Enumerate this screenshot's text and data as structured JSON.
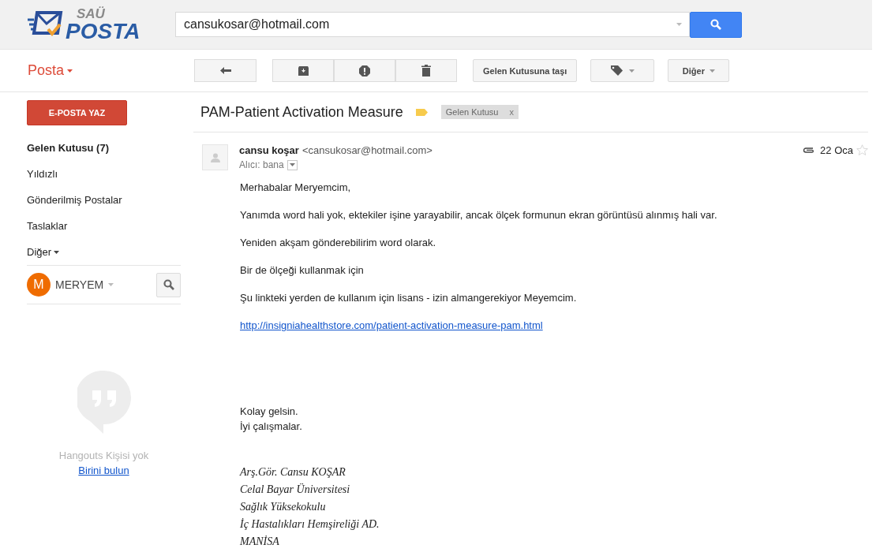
{
  "header": {
    "logo_top": "SAÜ",
    "logo_bottom": "POSTA",
    "search": {
      "value": "cansukosar@hotmail.com"
    }
  },
  "app_menu": "Posta",
  "toolbar": {
    "groups": [
      [
        {
          "kind": "reply"
        }
      ],
      [
        {
          "kind": "archive"
        },
        {
          "kind": "spam"
        },
        {
          "kind": "delete"
        }
      ]
    ],
    "move_button": "Gelen Kutusuna taşı",
    "more_button": "Diğer"
  },
  "sidebar": {
    "compose": "E-POSTA YAZ",
    "items": [
      {
        "label": "Gelen Kutusu (7)",
        "selected": true,
        "kind": "link"
      },
      {
        "label": "Yıldızlı",
        "selected": false,
        "kind": "link"
      },
      {
        "label": "Gönderilmiş Postalar",
        "selected": false,
        "kind": "link"
      },
      {
        "label": "Taslaklar",
        "selected": false,
        "kind": "link"
      },
      {
        "label": "Diğer",
        "selected": false,
        "kind": "menu"
      }
    ],
    "user": {
      "initial": "M",
      "name": "MERYEM"
    },
    "hangouts": {
      "empty_text": "Hangouts Kişisi yok",
      "link": "Birini bulun"
    }
  },
  "message": {
    "subject": "PAM-Patient Activation Measure",
    "label": "Gelen Kutusu",
    "label_remove": "x",
    "sender_name": "cansu koşar",
    "sender_email": "<cansukosar@hotmail.com>",
    "recipient": "Alıcı: bana",
    "date": "22 Oca",
    "has_attachment": true,
    "starred": false,
    "body": [
      {
        "kind": "paragraph",
        "text": "Merhabalar Meryemcim,"
      },
      {
        "kind": "paragraph",
        "text": "Yanımda word hali yok, ektekiler işine yarayabilir, ancak ölçek formunun ekran görüntüsü alınmış hali var."
      },
      {
        "kind": "paragraph",
        "text": "Yeniden akşam gönderebilirim word olarak."
      },
      {
        "kind": "paragraph",
        "text": "Bir de ölçeği kullanmak için"
      },
      {
        "kind": "paragraph",
        "text": "Şu linkteki yerden de kullanım için lisans - izin almangerekiyor Meyemcim."
      },
      {
        "kind": "link",
        "text": "http://insigniahealthstore.com/patient-activation-measure-pam.html"
      }
    ],
    "closing": [
      "Kolay gelsin.",
      "İyi çalışmalar."
    ],
    "signature": [
      "Arş.Gör. Cansu KOŞAR",
      "Celal Bayar Üniversitesi",
      "Sağlık Yüksekokulu",
      "İç Hastalıkları Hemşireliği AD.",
      "MANİSA"
    ]
  }
}
